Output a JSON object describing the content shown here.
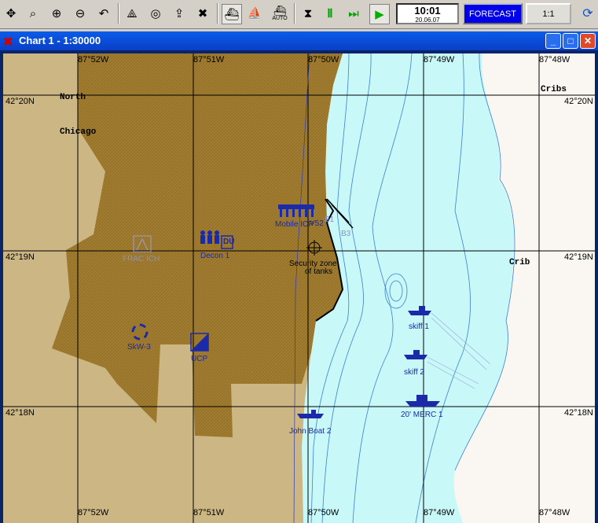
{
  "toolbar": {
    "tools": [
      {
        "icon": "move-icon",
        "glyph": "✥"
      },
      {
        "icon": "zoom-window-icon",
        "glyph": "⌕"
      },
      {
        "icon": "zoom-in-icon",
        "glyph": "⊕"
      },
      {
        "icon": "zoom-out-icon",
        "glyph": "⊖"
      },
      {
        "icon": "undo-icon",
        "glyph": "↶"
      },
      {
        "icon": "draw-icon",
        "glyph": "⟁"
      },
      {
        "icon": "target-icon",
        "glyph": "◎"
      },
      {
        "icon": "export-icon",
        "glyph": "⇪"
      },
      {
        "icon": "delete-icon",
        "glyph": "✖"
      },
      {
        "icon": "ship-track-icon",
        "glyph": "⛴"
      },
      {
        "icon": "ship-icon",
        "glyph": "⛵"
      },
      {
        "icon": "auto-ship-icon",
        "glyph": "⛴"
      },
      {
        "icon": "stop-icon",
        "glyph": "⧗"
      },
      {
        "icon": "pause-icon",
        "glyph": "Ⅱ"
      },
      {
        "icon": "fast-forward-icon",
        "glyph": "⏭"
      },
      {
        "icon": "play-icon",
        "glyph": "▶"
      }
    ],
    "auto_label": "AUTO",
    "time": "10:01",
    "date": "20.06.07",
    "forecast_label": "FORECAST",
    "scale_label": "1:1"
  },
  "window": {
    "title": "Chart 1 - 1:30000",
    "minimize": "_",
    "maximize": "□",
    "close": "✕"
  },
  "map": {
    "lon_labels_top": [
      "87°52W",
      "87°51W",
      "87°50W",
      "87°49W",
      "87°48W"
    ],
    "lon_labels_bottom": [
      "87°52W",
      "87°51W",
      "87°50W",
      "87°49W",
      "87°48W"
    ],
    "lat_labels_left": [
      "42°20N",
      "42°19N",
      "42°18N"
    ],
    "lat_labels_right": [
      "42°20N",
      "42°19N",
      "42°18N"
    ],
    "places": {
      "north": "North",
      "chicago": "Chicago",
      "cribs": "Cribs",
      "crib": "Crib"
    },
    "units": {
      "mobile_icp": "Mobile ICP",
      "v52": "V52",
      "frac_ich": "FRAC ICH",
      "decon": "Decon 1",
      "du": "DU",
      "security_zone": "Security zone",
      "of_tanks": "of tanks",
      "skw": "SkW-3",
      "ucp": "UCP",
      "skiff1": "skiff 1",
      "skiff2": "skiff 2",
      "merc": "20' MERC 1",
      "john_boat": "John Boat 2",
      "b1": "B1",
      "b3": "B3"
    },
    "colors": {
      "land": "#c8b483",
      "urban": "#9c7a2f",
      "water": "#c8f8f8",
      "deep": "#f6f0ec",
      "unit": "#1a2aa8"
    }
  }
}
